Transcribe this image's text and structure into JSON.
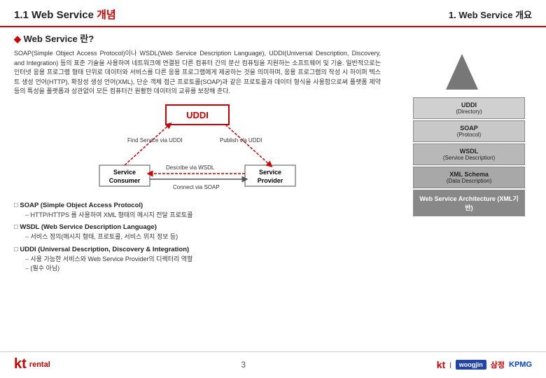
{
  "header": {
    "left_title": "1.1 Web Service 개념",
    "right_title": "1. Web Service 개요"
  },
  "section": {
    "title": "Web Service 란?",
    "description": "SOAP(Simple Object Access Protocol)이나 WSDL(Web Service Description Language), UDDI(Universal Description, Discovery, and Integration) 등의 표준 기술을 사용하여 네트워크에 연결된 다른 컴퓨터 간의 분산 컴퓨팅을 지원하는 소프트웨어 및 기술. 일반적으로는 인터넷 응용 프로그램 형태 단위로 데이터와 서비스를 다른 응용 프로그램에게 제공하는 것을 의미하며, 응용 프로그램의 작성 시 하이퍼 텍스트 생성 언어(HTTP), 확장성 생성 언어(XML), 단순 객체 접근 프로토콜(SOAP)과 같은 프로토콜과 데이터 형식을 사용함으로써 플랫폼 제약 등의 특성을 플랫폼과 상관없이 모든 컴퓨터간 원활한 데이터의 교류를 보장해 준다."
  },
  "diagram": {
    "uddi_label": "UDDI",
    "find_label": "Find Service via UDDI",
    "publish_label": "Publish via UDDI",
    "wsdl_label": "Describe via WSDL",
    "soap_label": "Connect via SOAP",
    "consumer_label": "Service\nConsumer",
    "provider_label": "Service\nProvider"
  },
  "bullets": [
    {
      "title": "SOAP (Simple Object Access Protocol)",
      "subs": [
        "HTTP/HTTPS 를 사용하여 XML 형태의 메시지 전달 프로토콜"
      ]
    },
    {
      "title": "WSDL (Web Service Description Language)",
      "subs": [
        "서비스 정의(메시지 형태, 프로토콜, 서비스 위치 정보 등)"
      ]
    },
    {
      "title": "UDDI (Universal Description, Discovery & Integration)",
      "subs": [
        "사용 가능한 서비스와 Web Service Provider의 디렉터리 역할",
        "(필수 아님)"
      ]
    }
  ],
  "pyramid": {
    "items": [
      {
        "label": "UDDI",
        "sub": "(Directory)",
        "class": "stack-uddi"
      },
      {
        "label": "SOAP",
        "sub": "(Protocol)",
        "class": "stack-soap"
      },
      {
        "label": "WSDL",
        "sub": "(Service Description)",
        "class": "stack-wsdl"
      },
      {
        "label": "XML Schema",
        "sub": "(Data Description)",
        "class": "stack-xml"
      },
      {
        "label": "Web Service Architecture (XML기반)",
        "sub": "",
        "class": "stack-arch"
      }
    ]
  },
  "footer": {
    "logo_text": "kt",
    "rental_text": "rental",
    "page_number": "3",
    "company1": "kt",
    "company2": "woogjin",
    "company3": "삼정",
    "company4": "KPMG"
  }
}
